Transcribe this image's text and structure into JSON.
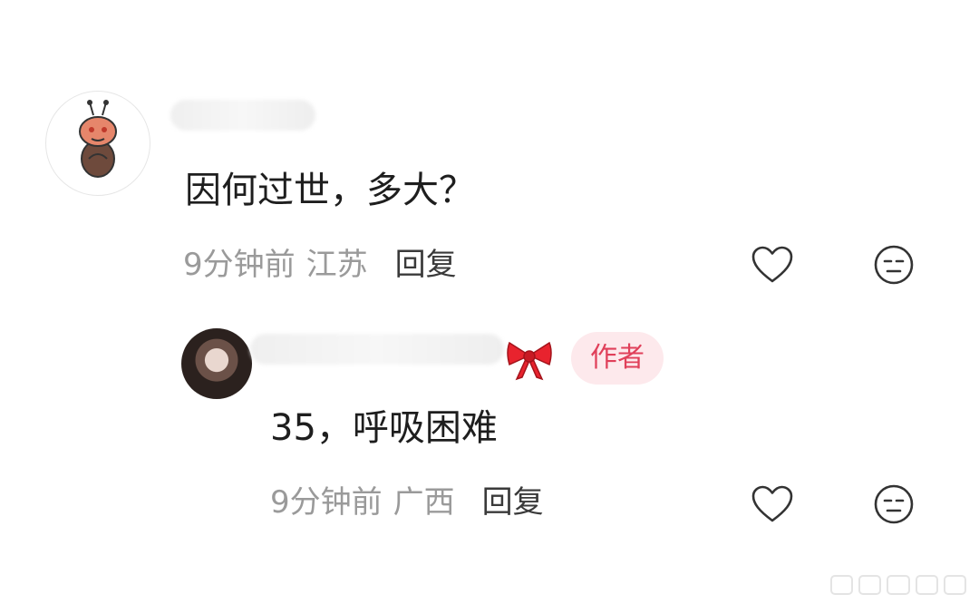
{
  "comments": [
    {
      "text": "因何过世，多大？",
      "time": "9分钟前",
      "location": "江苏",
      "reply_label": "回复"
    },
    {
      "text": "35，呼吸困难",
      "time": "9分钟前",
      "location": "广西",
      "reply_label": "回复",
      "author_badge": "作者"
    }
  ],
  "icons": {
    "like": "heart-icon",
    "dislike": "neutral-face-icon",
    "decoration": "bow-icon"
  },
  "colors": {
    "badge_bg": "#fde9ec",
    "badge_text": "#e0405a",
    "meta_text": "#9a9a9a",
    "bow": "#e8232e"
  }
}
